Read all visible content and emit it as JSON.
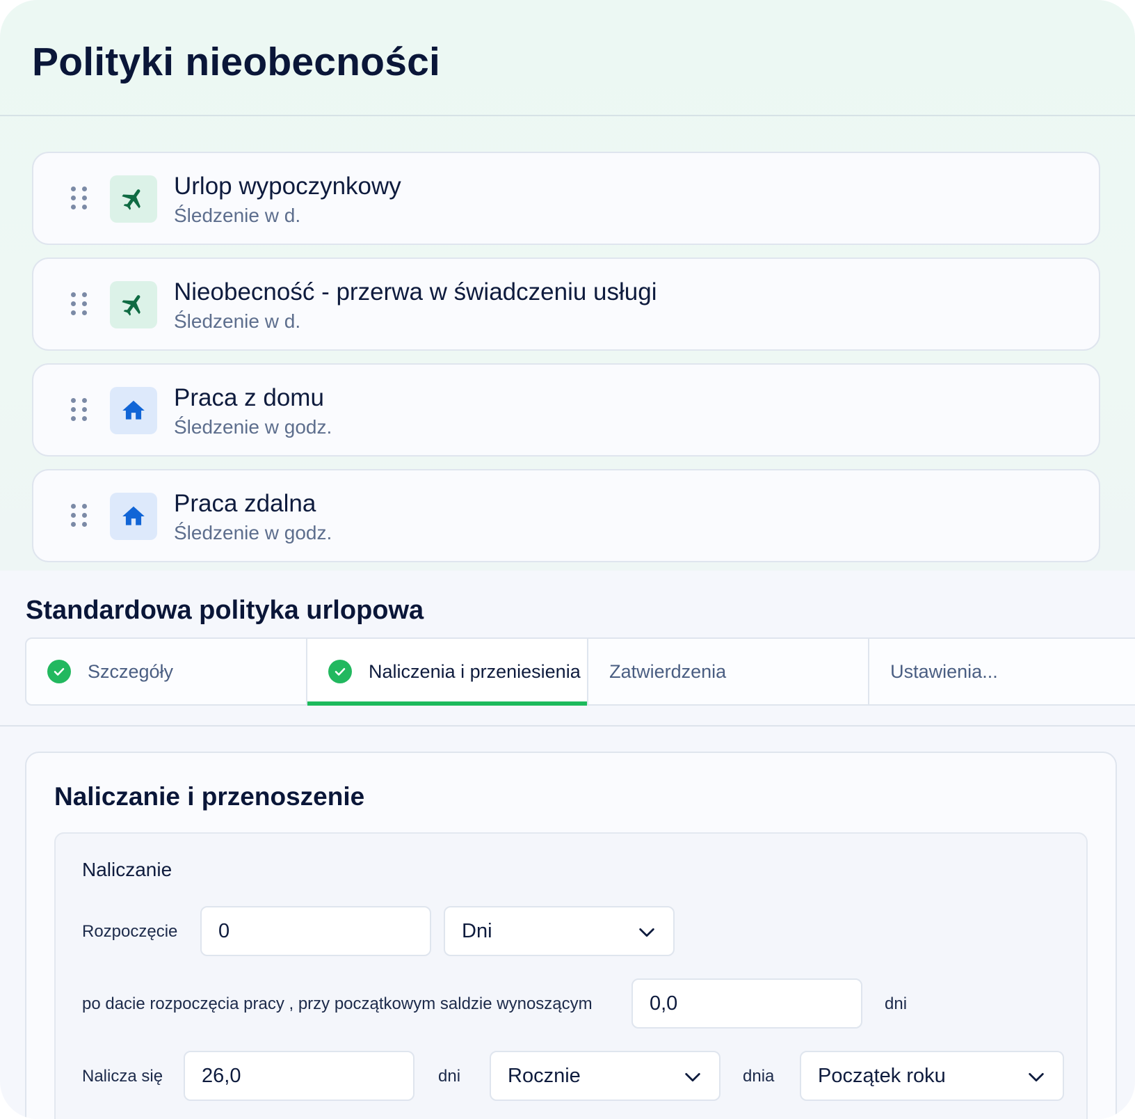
{
  "header": {
    "title": "Polityki nieobecności"
  },
  "policies": [
    {
      "name": "Urlop wypoczynkowy",
      "tracking": "Śledzenie w d.",
      "icon": "airplane-icon"
    },
    {
      "name": "Nieobecność - przerwa w świadczeniu usługi",
      "tracking": "Śledzenie w d.",
      "icon": "airplane-icon"
    },
    {
      "name": "Praca z domu",
      "tracking": "Śledzenie w godz.",
      "icon": "home-icon"
    },
    {
      "name": "Praca zdalna",
      "tracking": "Śledzenie w godz.",
      "icon": "home-icon"
    }
  ],
  "policy_editor": {
    "title": "Standardowa polityka urlopowa",
    "tabs": [
      {
        "label": "Szczegóły",
        "completed": true,
        "active": false
      },
      {
        "label": "Naliczenia i przeniesienia",
        "completed": true,
        "active": true
      },
      {
        "label": "Zatwierdzenia",
        "completed": false,
        "active": false
      },
      {
        "label": "Ustawienia...",
        "completed": false,
        "active": false
      }
    ],
    "panel": {
      "title": "Naliczanie i przenoszenie",
      "accrual": {
        "title": "Naliczanie",
        "start_label": "Rozpoczęcie",
        "start_value": "0",
        "start_unit": "Dni",
        "after_start_text": "po dacie rozpoczęcia pracy , przy początkowym saldzie wynoszącym",
        "initial_balance": "0,0",
        "initial_balance_unit": "dni",
        "accrues_label": "Nalicza się",
        "accrues_value": "26,0",
        "accrues_unit": "dni",
        "frequency": "Rocznie",
        "day_label": "dnia",
        "day_value": "Początek roku"
      }
    }
  },
  "colors": {
    "accent_green": "#1dba5c",
    "title_navy": "#0a1638",
    "icon_green": "#0f6b43",
    "icon_blue": "#1165d6"
  }
}
